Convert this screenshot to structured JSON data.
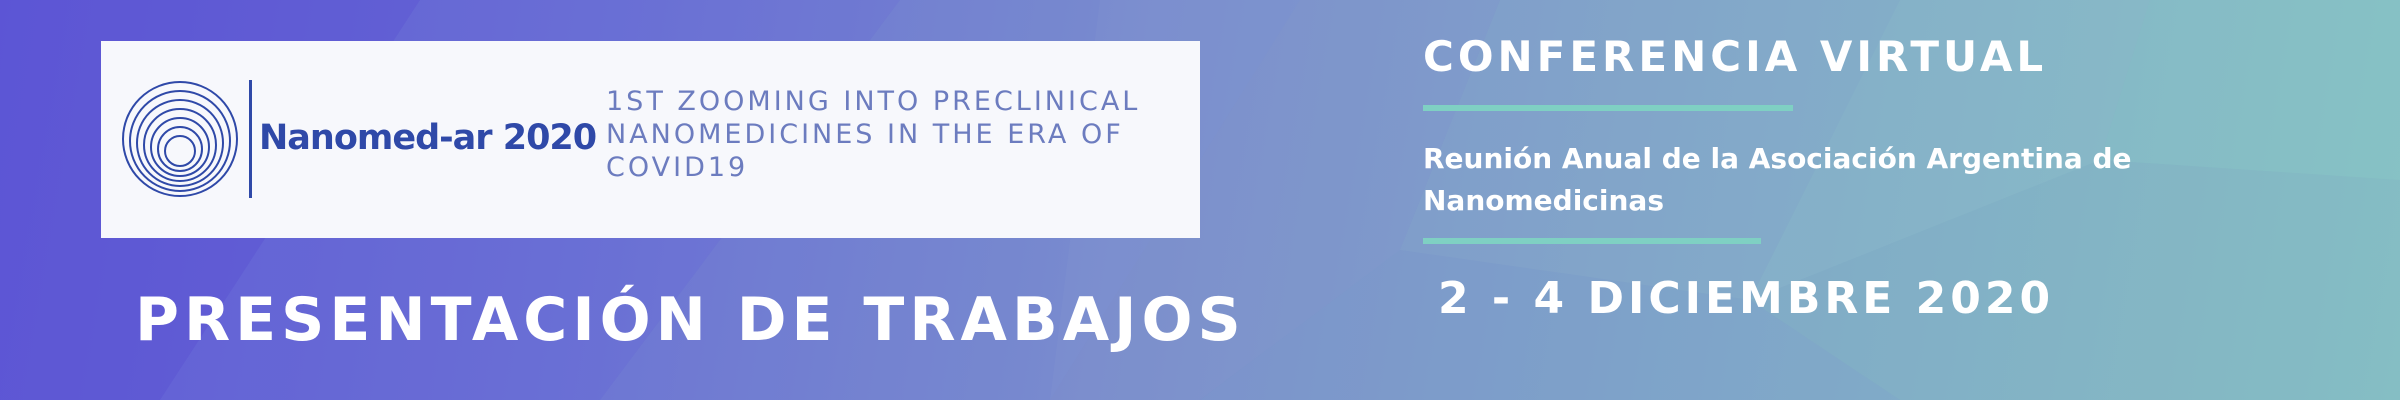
{
  "logo": {
    "name": "Nanomed-ar 2020",
    "tagline": "1ST ZOOMING INTO PRECLINICAL NANOMEDICINES IN THE ERA OF COVID19"
  },
  "main_title": "PRESENTACIÓN DE TRABAJOS",
  "conference": {
    "title": "CONFERENCIA VIRTUAL",
    "subtitle": "Reunión Anual de la Asociación Argentina de Nanomedicinas",
    "dates": "2 - 4 DICIEMBRE 2020"
  },
  "colors": {
    "logo_blue": "#2f49a8",
    "tagline": "#6c7cbf",
    "accent_line": "#7fd0c3",
    "text": "#ffffff"
  },
  "icons": [
    "concentric-circles-logo-icon"
  ]
}
